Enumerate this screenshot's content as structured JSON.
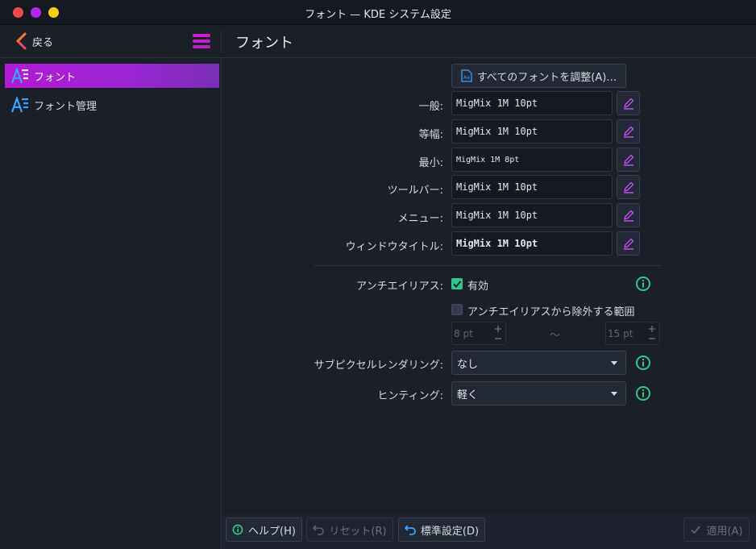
{
  "window": {
    "title": "フォント — KDE システム設定"
  },
  "header": {
    "back_label": "戻る",
    "page_title": "フォント"
  },
  "sidebar": {
    "items": [
      {
        "label": "フォント",
        "active": true
      },
      {
        "label": "フォント管理",
        "active": false
      }
    ]
  },
  "fonts": {
    "adjust_all_label": "すべてのフォントを調整(A)…",
    "rows": [
      {
        "label": "一般:",
        "value": "MigMix 1M 10pt"
      },
      {
        "label": "等幅:",
        "value": "MigMix 1M 10pt"
      },
      {
        "label": "最小:",
        "value": "MigMix 1M 8pt"
      },
      {
        "label": "ツールバー:",
        "value": "MigMix 1M 10pt"
      },
      {
        "label": "メニュー:",
        "value": "MigMix 1M 10pt"
      },
      {
        "label": "ウィンドウタイトル:",
        "value": "MigMix 1M 10pt"
      }
    ]
  },
  "antialiasing": {
    "label": "アンチエイリアス:",
    "enabled_label": "有効",
    "enabled_checked": true,
    "exclude_label": "アンチエイリアスから除外する範囲",
    "exclude_checked": false,
    "range_from": "8 pt",
    "range_separator": "〜",
    "range_to": "15 pt"
  },
  "subpixel": {
    "label": "サブピクセルレンダリング:",
    "value": "なし"
  },
  "hinting": {
    "label": "ヒンティング:",
    "value": "軽く"
  },
  "footer": {
    "help_label": "ヘルプ(H)",
    "reset_label": "リセット(R)",
    "defaults_label": "標準設定(D)",
    "apply_label": "適用(A)"
  },
  "colors": {
    "accent": "#b31ad6",
    "edit_icon": "#c24df0",
    "info_icon": "#2ec58f",
    "checkbox_checked": "#2ec58f"
  }
}
